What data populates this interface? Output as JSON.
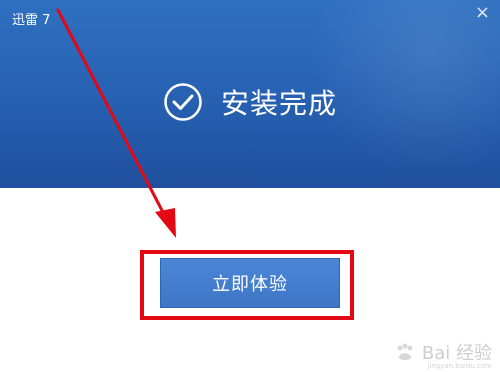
{
  "window": {
    "title": "迅雷 7",
    "close_glyph": "×"
  },
  "status": {
    "icon": "check-circle-icon",
    "message": "安装完成"
  },
  "action": {
    "primary_label": "立即体验"
  },
  "annotations": {
    "highlight_color": "#e30914",
    "arrow_color": "#e30914"
  },
  "watermark": {
    "text": "Bai 经验",
    "subtext": "jingyan.baidu.com",
    "icon": "baidu-paw-icon"
  },
  "colors": {
    "header_blue": "#2f70c1",
    "button_blue": "#4b86d6"
  }
}
